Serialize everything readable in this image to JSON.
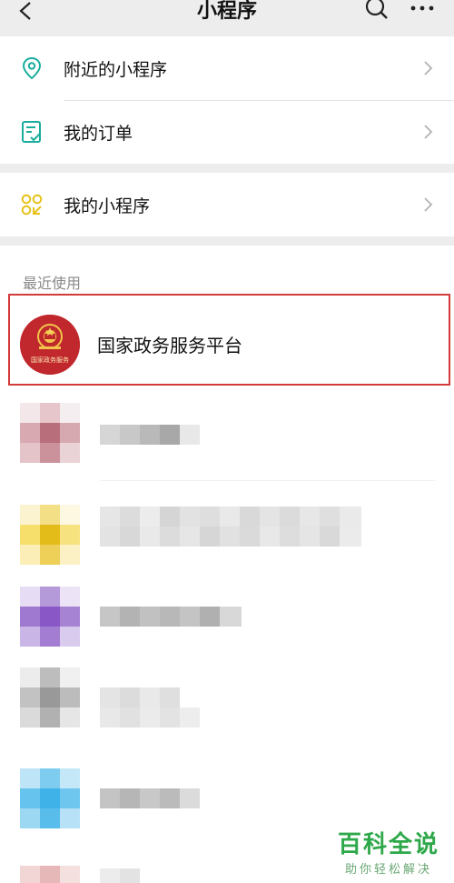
{
  "header": {
    "title": "小程序",
    "back_icon": "chevron-left-icon",
    "search_icon": "search-icon",
    "more_icon": "more-icon"
  },
  "menu": {
    "nearby": {
      "label": "附近的小程序",
      "icon": "location-pin-icon"
    },
    "orders": {
      "label": "我的订单",
      "icon": "order-list-icon"
    },
    "mine": {
      "label": "我的小程序",
      "icon": "mini-program-icon"
    }
  },
  "recent": {
    "title": "最近使用",
    "highlighted": {
      "name": "国家政务服务平台",
      "emblem_text": "国家政务服务"
    }
  },
  "watermark": {
    "brand": "百科全说",
    "tagline": "助你轻松解决"
  },
  "colors": {
    "teal": "#1aad9c",
    "yellow": "#e6c21b",
    "highlight": "#d33a3a",
    "emblem": "#c0282d",
    "watermark": "#2ea84a"
  }
}
